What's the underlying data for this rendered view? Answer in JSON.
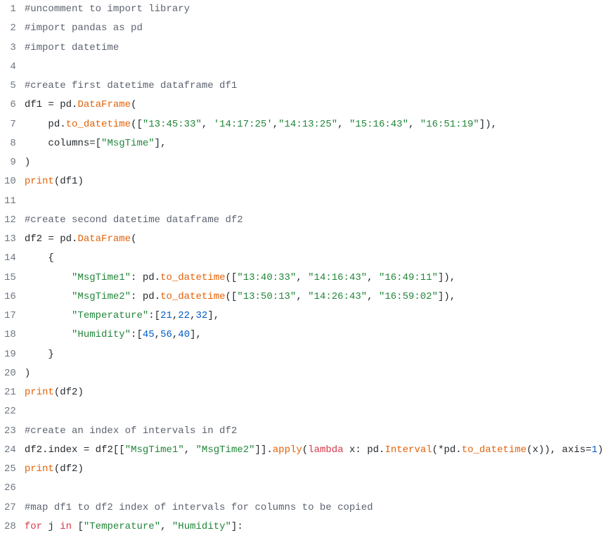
{
  "code": {
    "lines": [
      {
        "num": "1",
        "tokens": [
          {
            "cls": "cmt",
            "t": "#uncomment to import library"
          }
        ]
      },
      {
        "num": "2",
        "tokens": [
          {
            "cls": "cmt",
            "t": "#import pandas as pd"
          }
        ]
      },
      {
        "num": "3",
        "tokens": [
          {
            "cls": "cmt",
            "t": "#import datetime"
          }
        ]
      },
      {
        "num": "4",
        "tokens": []
      },
      {
        "num": "5",
        "tokens": [
          {
            "cls": "cmt",
            "t": "#create first datetime dataframe df1"
          }
        ]
      },
      {
        "num": "6",
        "tokens": [
          {
            "cls": "nm",
            "t": "df1 "
          },
          {
            "cls": "op",
            "t": "= "
          },
          {
            "cls": "nm",
            "t": "pd"
          },
          {
            "cls": "op",
            "t": "."
          },
          {
            "cls": "fn",
            "t": "DataFrame"
          },
          {
            "cls": "par",
            "t": "("
          }
        ]
      },
      {
        "num": "7",
        "tokens": [
          {
            "cls": "nm",
            "t": "    pd"
          },
          {
            "cls": "op",
            "t": "."
          },
          {
            "cls": "fn",
            "t": "to_datetime"
          },
          {
            "cls": "par",
            "t": "(["
          },
          {
            "cls": "str",
            "t": "\"13:45:33\""
          },
          {
            "cls": "par",
            "t": ", "
          },
          {
            "cls": "str",
            "t": "'14:17:25'"
          },
          {
            "cls": "par",
            "t": ","
          },
          {
            "cls": "str",
            "t": "\"14:13:25\""
          },
          {
            "cls": "par",
            "t": ", "
          },
          {
            "cls": "str",
            "t": "\"15:16:43\""
          },
          {
            "cls": "par",
            "t": ", "
          },
          {
            "cls": "str",
            "t": "\"16:51:19\""
          },
          {
            "cls": "par",
            "t": "]),"
          }
        ]
      },
      {
        "num": "8",
        "tokens": [
          {
            "cls": "nm",
            "t": "    columns"
          },
          {
            "cls": "op",
            "t": "="
          },
          {
            "cls": "par",
            "t": "["
          },
          {
            "cls": "str",
            "t": "\"MsgTime\""
          },
          {
            "cls": "par",
            "t": "],"
          }
        ]
      },
      {
        "num": "9",
        "tokens": [
          {
            "cls": "par",
            "t": ")"
          }
        ]
      },
      {
        "num": "10",
        "tokens": [
          {
            "cls": "fn",
            "t": "print"
          },
          {
            "cls": "par",
            "t": "("
          },
          {
            "cls": "nm",
            "t": "df1"
          },
          {
            "cls": "par",
            "t": ")"
          }
        ]
      },
      {
        "num": "11",
        "tokens": []
      },
      {
        "num": "12",
        "tokens": [
          {
            "cls": "cmt",
            "t": "#create second datetime dataframe df2"
          }
        ]
      },
      {
        "num": "13",
        "tokens": [
          {
            "cls": "nm",
            "t": "df2 "
          },
          {
            "cls": "op",
            "t": "= "
          },
          {
            "cls": "nm",
            "t": "pd"
          },
          {
            "cls": "op",
            "t": "."
          },
          {
            "cls": "fn",
            "t": "DataFrame"
          },
          {
            "cls": "par",
            "t": "("
          }
        ]
      },
      {
        "num": "14",
        "tokens": [
          {
            "cls": "par",
            "t": "    {"
          }
        ]
      },
      {
        "num": "15",
        "tokens": [
          {
            "cls": "nm",
            "t": "        "
          },
          {
            "cls": "str",
            "t": "\"MsgTime1\""
          },
          {
            "cls": "par",
            "t": ": "
          },
          {
            "cls": "nm",
            "t": "pd"
          },
          {
            "cls": "op",
            "t": "."
          },
          {
            "cls": "fn",
            "t": "to_datetime"
          },
          {
            "cls": "par",
            "t": "(["
          },
          {
            "cls": "str",
            "t": "\"13:40:33\""
          },
          {
            "cls": "par",
            "t": ", "
          },
          {
            "cls": "str",
            "t": "\"14:16:43\""
          },
          {
            "cls": "par",
            "t": ", "
          },
          {
            "cls": "str",
            "t": "\"16:49:11\""
          },
          {
            "cls": "par",
            "t": "]),"
          }
        ]
      },
      {
        "num": "16",
        "tokens": [
          {
            "cls": "nm",
            "t": "        "
          },
          {
            "cls": "str",
            "t": "\"MsgTime2\""
          },
          {
            "cls": "par",
            "t": ": "
          },
          {
            "cls": "nm",
            "t": "pd"
          },
          {
            "cls": "op",
            "t": "."
          },
          {
            "cls": "fn",
            "t": "to_datetime"
          },
          {
            "cls": "par",
            "t": "(["
          },
          {
            "cls": "str",
            "t": "\"13:50:13\""
          },
          {
            "cls": "par",
            "t": ", "
          },
          {
            "cls": "str",
            "t": "\"14:26:43\""
          },
          {
            "cls": "par",
            "t": ", "
          },
          {
            "cls": "str",
            "t": "\"16:59:02\""
          },
          {
            "cls": "par",
            "t": "]),"
          }
        ]
      },
      {
        "num": "17",
        "tokens": [
          {
            "cls": "nm",
            "t": "        "
          },
          {
            "cls": "str",
            "t": "\"Temperature\""
          },
          {
            "cls": "par",
            "t": ":["
          },
          {
            "cls": "num",
            "t": "21"
          },
          {
            "cls": "par",
            "t": ","
          },
          {
            "cls": "num",
            "t": "22"
          },
          {
            "cls": "par",
            "t": ","
          },
          {
            "cls": "num",
            "t": "32"
          },
          {
            "cls": "par",
            "t": "],"
          }
        ]
      },
      {
        "num": "18",
        "tokens": [
          {
            "cls": "nm",
            "t": "        "
          },
          {
            "cls": "str",
            "t": "\"Humidity\""
          },
          {
            "cls": "par",
            "t": ":["
          },
          {
            "cls": "num",
            "t": "45"
          },
          {
            "cls": "par",
            "t": ","
          },
          {
            "cls": "num",
            "t": "56"
          },
          {
            "cls": "par",
            "t": ","
          },
          {
            "cls": "num",
            "t": "40"
          },
          {
            "cls": "par",
            "t": "],"
          }
        ]
      },
      {
        "num": "19",
        "tokens": [
          {
            "cls": "par",
            "t": "    }"
          }
        ]
      },
      {
        "num": "20",
        "tokens": [
          {
            "cls": "par",
            "t": ")"
          }
        ]
      },
      {
        "num": "21",
        "tokens": [
          {
            "cls": "fn",
            "t": "print"
          },
          {
            "cls": "par",
            "t": "("
          },
          {
            "cls": "nm",
            "t": "df2"
          },
          {
            "cls": "par",
            "t": ")"
          }
        ]
      },
      {
        "num": "22",
        "tokens": []
      },
      {
        "num": "23",
        "tokens": [
          {
            "cls": "cmt",
            "t": "#create an index of intervals in df2"
          }
        ]
      },
      {
        "num": "24",
        "tokens": [
          {
            "cls": "nm",
            "t": "df2"
          },
          {
            "cls": "op",
            "t": "."
          },
          {
            "cls": "nm",
            "t": "index "
          },
          {
            "cls": "op",
            "t": "= "
          },
          {
            "cls": "nm",
            "t": "df2"
          },
          {
            "cls": "par",
            "t": "[["
          },
          {
            "cls": "str",
            "t": "\"MsgTime1\""
          },
          {
            "cls": "par",
            "t": ", "
          },
          {
            "cls": "str",
            "t": "\"MsgTime2\""
          },
          {
            "cls": "par",
            "t": "]]"
          },
          {
            "cls": "op",
            "t": "."
          },
          {
            "cls": "fn",
            "t": "apply"
          },
          {
            "cls": "par",
            "t": "("
          },
          {
            "cls": "kw",
            "t": "lambda"
          },
          {
            "cls": "nm",
            "t": " x"
          },
          {
            "cls": "par",
            "t": ": "
          },
          {
            "cls": "nm",
            "t": "pd"
          },
          {
            "cls": "op",
            "t": "."
          },
          {
            "cls": "fn",
            "t": "Interval"
          },
          {
            "cls": "par",
            "t": "("
          },
          {
            "cls": "op",
            "t": "*"
          },
          {
            "cls": "nm",
            "t": "pd"
          },
          {
            "cls": "op",
            "t": "."
          },
          {
            "cls": "fn",
            "t": "to_datetime"
          },
          {
            "cls": "par",
            "t": "("
          },
          {
            "cls": "nm",
            "t": "x"
          },
          {
            "cls": "par",
            "t": ")), "
          },
          {
            "cls": "nm",
            "t": "axis"
          },
          {
            "cls": "op",
            "t": "="
          },
          {
            "cls": "num",
            "t": "1"
          },
          {
            "cls": "par",
            "t": ")"
          }
        ]
      },
      {
        "num": "25",
        "tokens": [
          {
            "cls": "fn",
            "t": "print"
          },
          {
            "cls": "par",
            "t": "("
          },
          {
            "cls": "nm",
            "t": "df2"
          },
          {
            "cls": "par",
            "t": ")"
          }
        ]
      },
      {
        "num": "26",
        "tokens": []
      },
      {
        "num": "27",
        "tokens": [
          {
            "cls": "cmt",
            "t": "#map df1 to df2 index of intervals for columns to be copied"
          }
        ]
      },
      {
        "num": "28",
        "tokens": [
          {
            "cls": "kw",
            "t": "for"
          },
          {
            "cls": "nm",
            "t": " j "
          },
          {
            "cls": "kw",
            "t": "in"
          },
          {
            "cls": "par",
            "t": " ["
          },
          {
            "cls": "str",
            "t": "\"Temperature\""
          },
          {
            "cls": "par",
            "t": ", "
          },
          {
            "cls": "str",
            "t": "\"Humidity\""
          },
          {
            "cls": "par",
            "t": "]:"
          }
        ]
      }
    ]
  }
}
